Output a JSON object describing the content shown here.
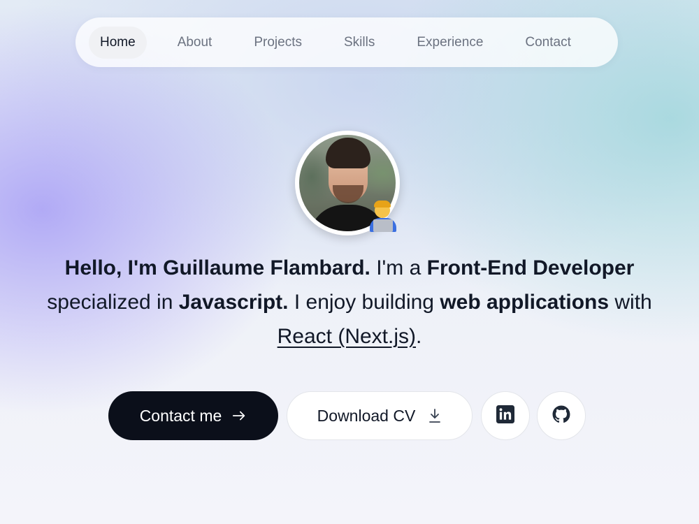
{
  "nav": {
    "items": [
      {
        "label": "Home",
        "active": true
      },
      {
        "label": "About"
      },
      {
        "label": "Projects"
      },
      {
        "label": "Skills"
      },
      {
        "label": "Experience"
      },
      {
        "label": "Contact"
      }
    ]
  },
  "hero": {
    "avatar_icon": "profile-photo",
    "badge_icon": "technologist-emoji",
    "line1": {
      "part1": "Hello, I'm Guillaume Flambard.",
      "part2": " I'm a ",
      "part3": "Front-End Developer"
    },
    "line2": {
      "part1": "specialized in ",
      "part2": "Javascript.",
      "part3": " I enjoy building ",
      "part4": "web applications",
      "part5": " with"
    },
    "line3": {
      "link": "React (Next.js)",
      "end": "."
    }
  },
  "actions": {
    "contact_label": "Contact me",
    "cv_label": "Download CV",
    "linkedin_icon": "linkedin-icon",
    "github_icon": "github-icon"
  },
  "colors": {
    "primary_button": "#0b0f1a",
    "text": "#111827",
    "muted_text": "#6b7280"
  }
}
